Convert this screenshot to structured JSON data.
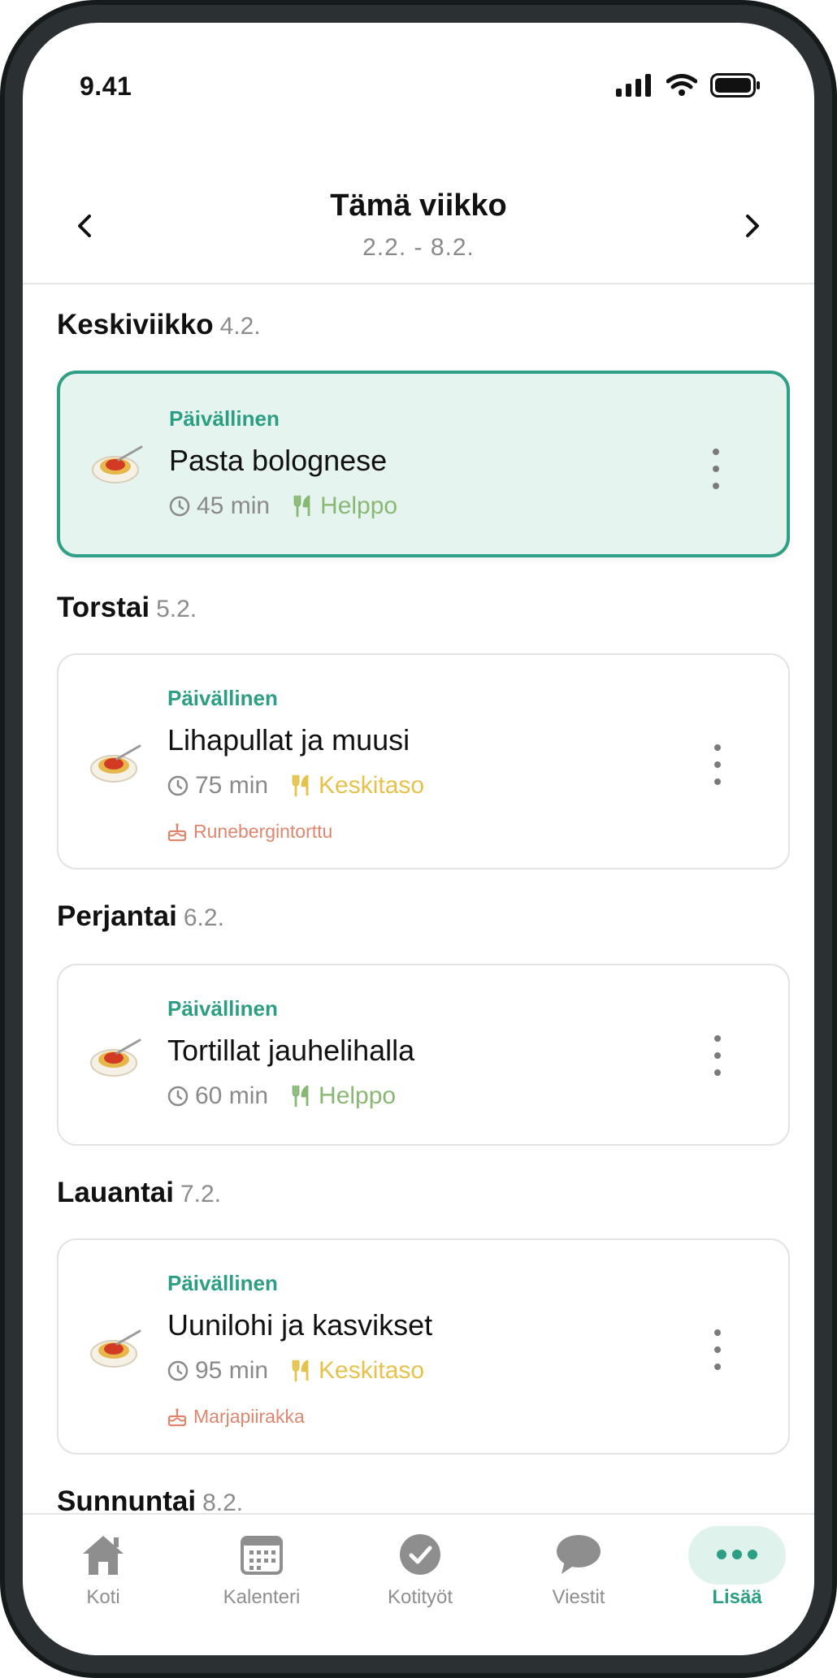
{
  "status_bar": {
    "time": "9.41",
    "icons": [
      "signal-icon",
      "wifi-icon",
      "battery-icon"
    ]
  },
  "header": {
    "title": "Tämä viikko",
    "range": "2.2. - 8.2."
  },
  "days": [
    {
      "name": "Keskiviikko",
      "date": "4.2.",
      "meal": {
        "type": "Päivällinen",
        "name": "Pasta bolognese",
        "time": "45 min",
        "difficulty": "Helppo",
        "dessert": "",
        "active": true
      }
    },
    {
      "name": "Torstai",
      "date": "5.2.",
      "meal": {
        "type": "Päivällinen",
        "name": "Lihapullat ja muusi",
        "time": "75 min",
        "difficulty": "Keskitaso",
        "dessert": "Runebergintorttu",
        "active": false
      }
    },
    {
      "name": "Perjantai",
      "date": "6.2.",
      "meal": {
        "type": "Päivällinen",
        "name": "Tortillat jauhelihalla",
        "time": "60 min",
        "difficulty": "Helppo",
        "dessert": "",
        "active": false
      }
    },
    {
      "name": "Lauantai",
      "date": "7.2.",
      "meal": {
        "type": "Päivällinen",
        "name": "Uunilohi ja kasvikset",
        "time": "95 min",
        "difficulty": "Keskitaso",
        "dessert": "Marjapiirakka",
        "active": false
      }
    },
    {
      "name": "Sunnuntai",
      "date": "8.2."
    }
  ],
  "tabs": [
    {
      "label": "Koti",
      "icon": "home-icon",
      "active": false
    },
    {
      "label": "Kalenteri",
      "icon": "calendar-icon",
      "active": false
    },
    {
      "label": "Kotityöt",
      "icon": "check-icon",
      "active": false
    },
    {
      "label": "Viestit",
      "icon": "chat-icon",
      "active": false
    },
    {
      "label": "Lisää",
      "icon": "more-icon",
      "active": true
    }
  ],
  "colors": {
    "accent": "#2b9e84",
    "active_card_bg": "#e5f4ef",
    "easy": "#89b874",
    "medium": "#e6c24c",
    "dessert": "#e0866e"
  }
}
